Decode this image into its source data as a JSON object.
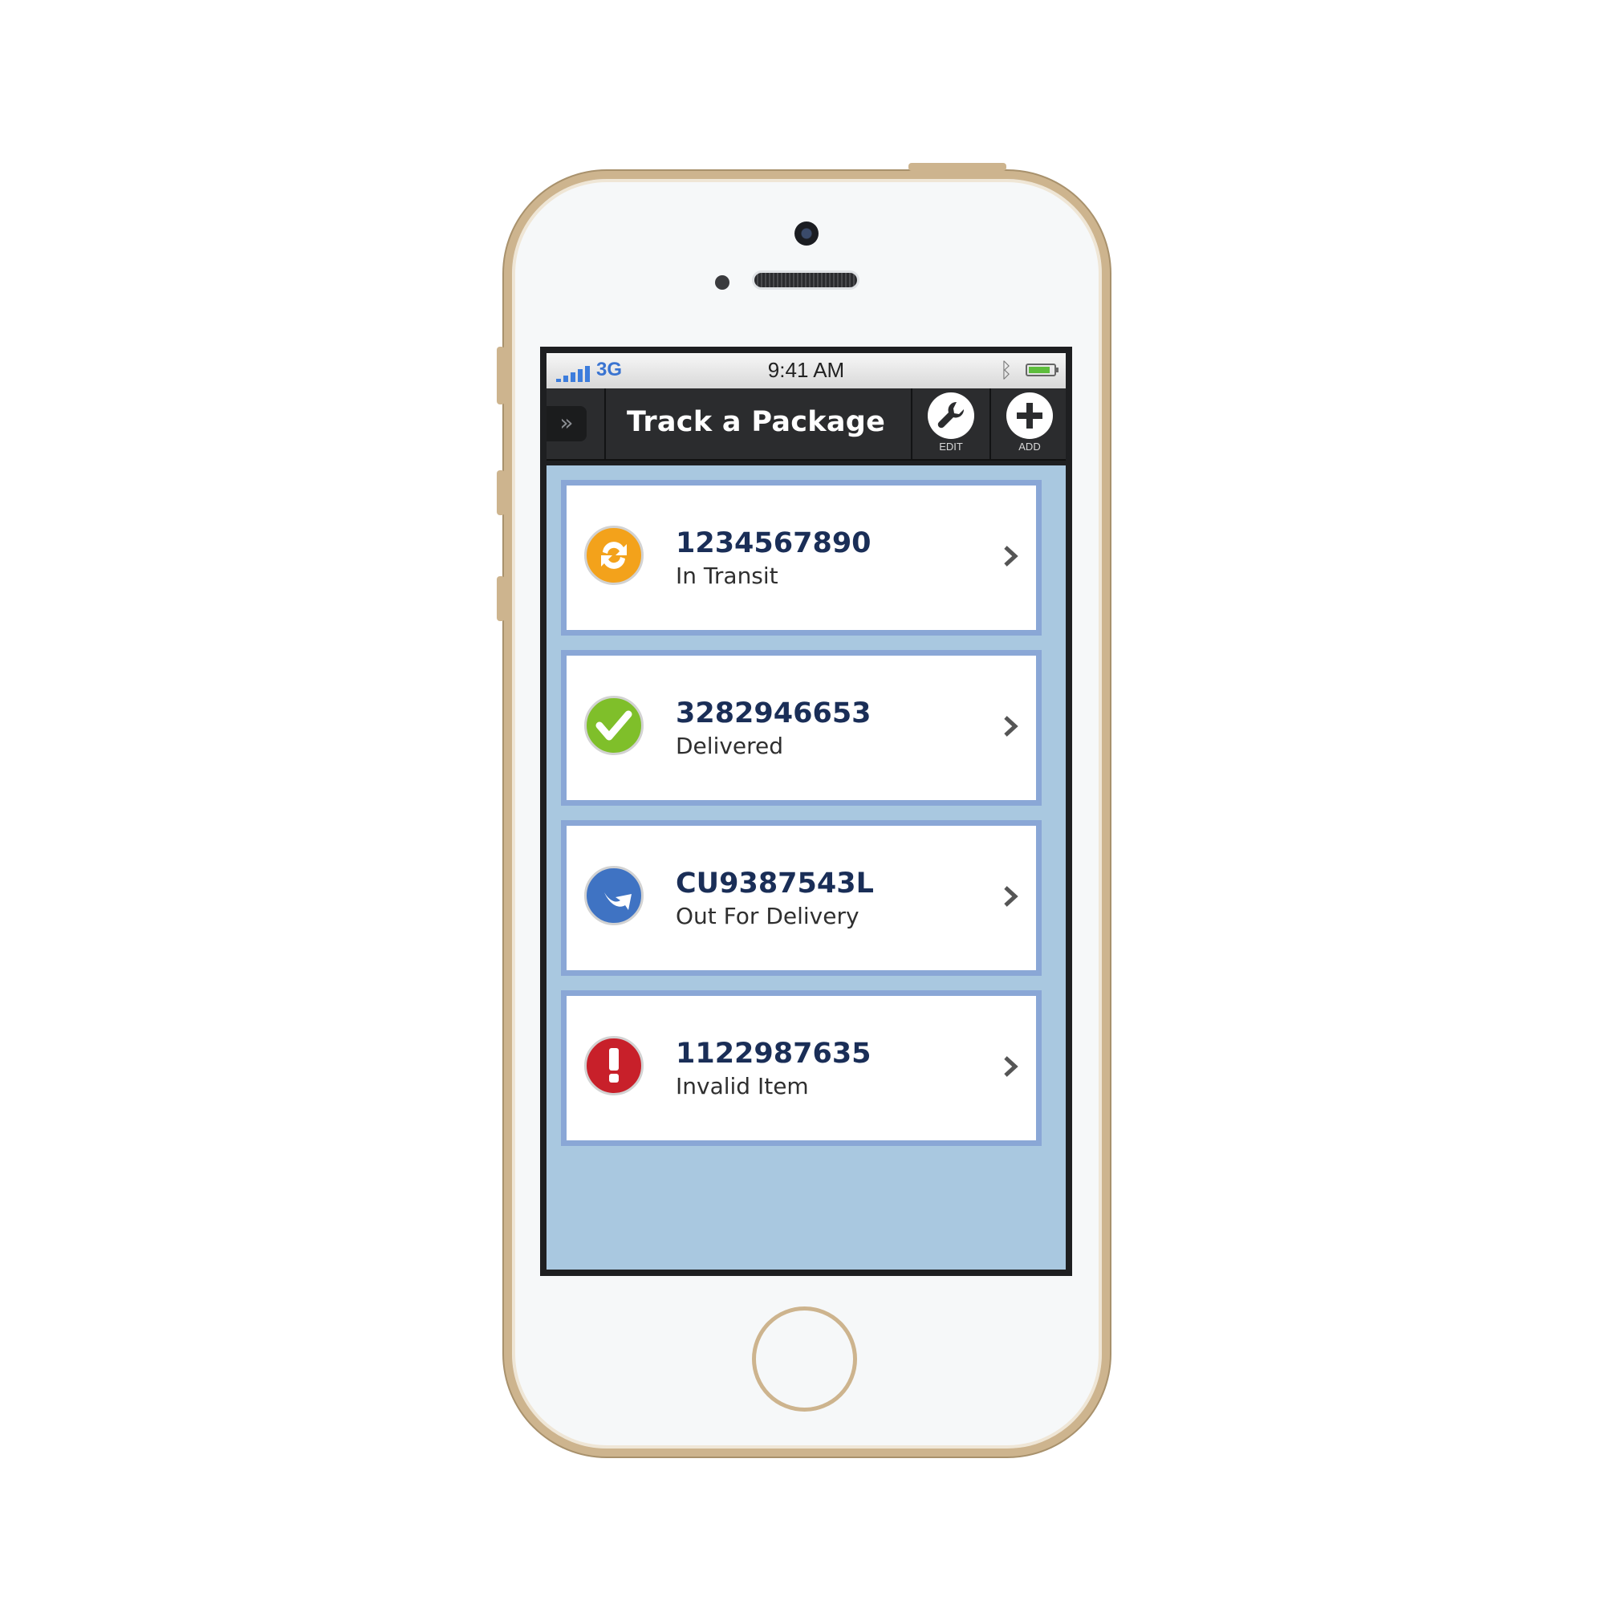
{
  "status_bar": {
    "network": "3G",
    "time": "9:41 AM",
    "bluetooth_icon": "bluetooth-icon",
    "battery_level": 0.85
  },
  "header": {
    "menu_icon": "double-chevron-right-icon",
    "title": "Track a Package",
    "edit_label": "EDIT",
    "edit_icon": "wrench-icon",
    "add_label": "ADD",
    "add_icon": "plus-circle-icon"
  },
  "packages": [
    {
      "tracking_number": "1234567890",
      "status": "In Transit",
      "icon": "in-transit-icon",
      "color": "#f3a21b"
    },
    {
      "tracking_number": "3282946653",
      "status": "Delivered",
      "icon": "delivered-check-icon",
      "color": "#7fbf2a"
    },
    {
      "tracking_number": "CU9387543L",
      "status": "Out For Delivery",
      "icon": "out-for-delivery-icon",
      "color": "#3f73c3"
    },
    {
      "tracking_number": "1122987635",
      "status": "Invalid Item",
      "icon": "invalid-alert-icon",
      "color": "#c8202a"
    }
  ],
  "colors": {
    "header_bg": "#2b2c2e",
    "list_bg": "#a9c8e0",
    "card_border": "#8aa7d6",
    "tracking_text": "#1a2e57"
  }
}
